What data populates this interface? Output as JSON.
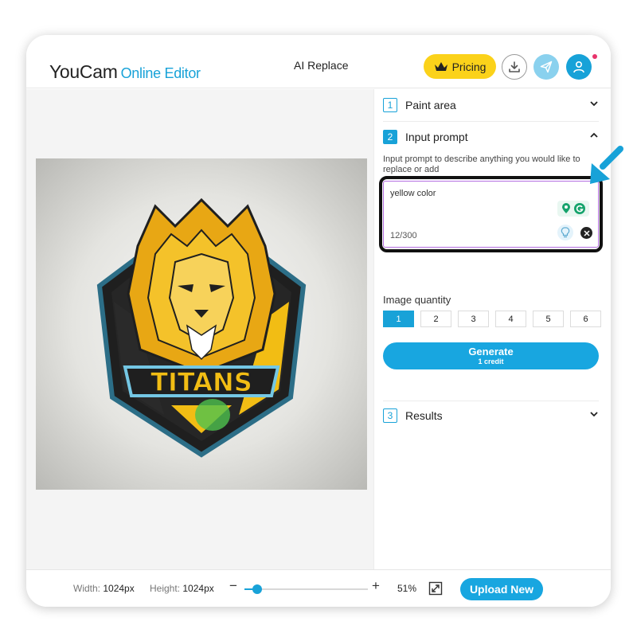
{
  "header": {
    "logo_brand": "YouCam",
    "logo_sub": "Online Editor",
    "tool_title": "AI Replace",
    "pricing_label": "Pricing",
    "icons": [
      "crown-icon",
      "download-icon",
      "send-icon",
      "user-icon"
    ]
  },
  "image": {
    "text": "TITANS"
  },
  "panel": {
    "sections": [
      {
        "number": "1",
        "label": "Paint area",
        "expanded": false
      },
      {
        "number": "2",
        "label": "Input prompt",
        "expanded": true
      },
      {
        "number": "3",
        "label": "Results",
        "expanded": false
      }
    ],
    "prompt": {
      "description": "Input prompt to describe anything you would like to replace or add",
      "value": "yellow color",
      "count": "12/300"
    },
    "quantity": {
      "label": "Image quantity",
      "options": [
        "1",
        "2",
        "3",
        "4",
        "5",
        "6"
      ],
      "selected": "1"
    },
    "generate": {
      "label": "Generate",
      "sub": "1 credit"
    }
  },
  "footer": {
    "width_label": "Width:",
    "width_value": "1024px",
    "height_label": "Height:",
    "height_value": "1024px",
    "zoom_minus": "−",
    "zoom_plus": "+",
    "zoom_value": "51%",
    "zoom_fraction": 0.1,
    "upload_label": "Upload New"
  },
  "colors": {
    "accent": "#18a2d8",
    "pricing": "#fbd21a",
    "notification": "#e8336b"
  }
}
